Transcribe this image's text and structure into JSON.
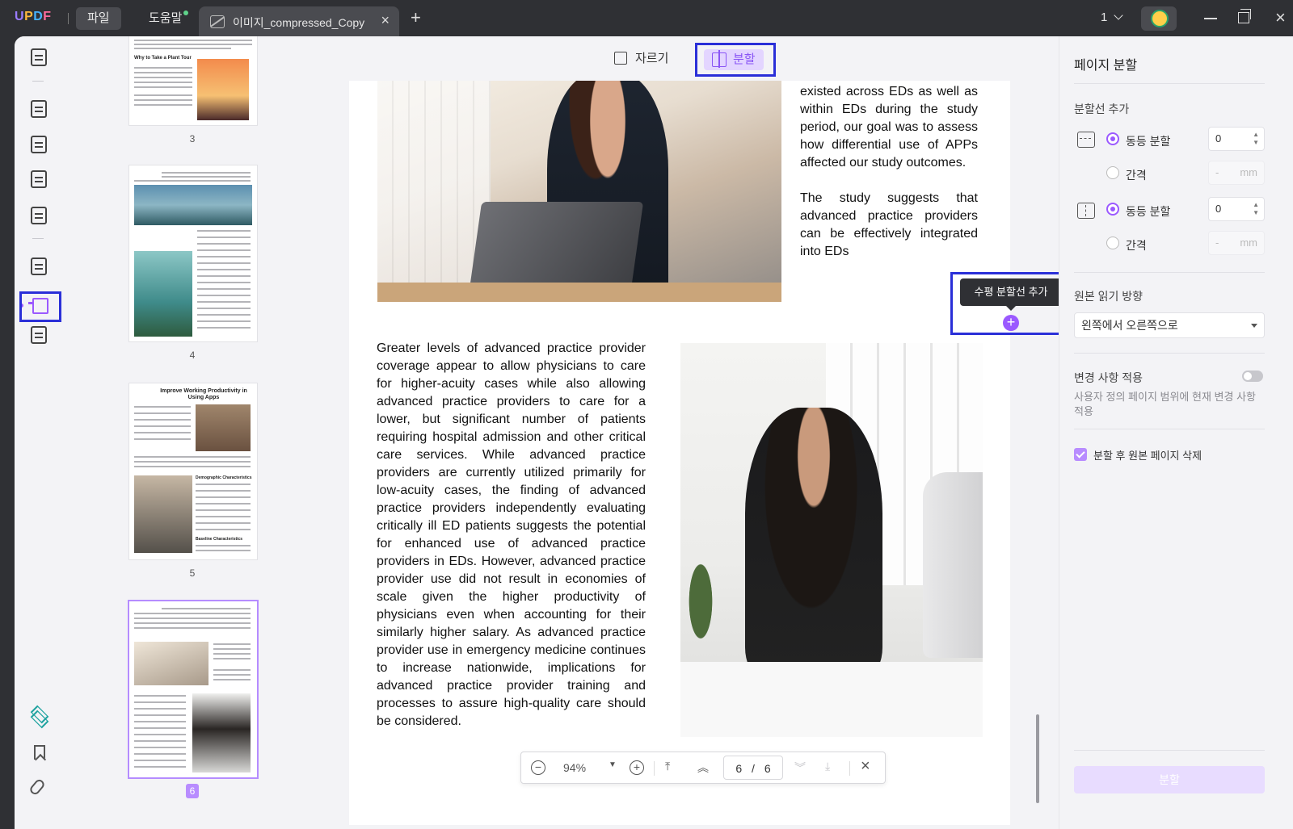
{
  "app": {
    "logo": "UPDF",
    "menu": [
      "파일",
      "도움말"
    ],
    "tab_title": "이미지_compressed_Copy",
    "page_indicator": "1",
    "accent_color": "#9b59ff"
  },
  "thumbnails": [
    {
      "page": "3",
      "heading": "Why to Take a Plant Tour",
      "selected": false
    },
    {
      "page": "4",
      "selected": false
    },
    {
      "page": "5",
      "heading": "Improve Working Productivity in Using Apps",
      "subheading_1": "Demographic Characteristics",
      "subheading_2": "Baseline Characteristics",
      "selected": false
    },
    {
      "page": "6",
      "selected": true
    }
  ],
  "subtoolbar": {
    "crop_label": "자르기",
    "split_label": "분할"
  },
  "document": {
    "right_para_1": "existed across EDs as well as within EDs during the study period, our goal was to assess how differential use of APPs affected our study outcomes.",
    "right_para_2": "The study suggests that advanced practice providers can be effectively integrated into EDs",
    "left_para": "Greater levels of advanced practice provider coverage appear to allow physicians to care for higher-acuity cases while also allowing advanced practice providers to care for a lower, but significant number of patients requiring hospital admission and other critical care services. While advanced practice providers are currently utilized primarily for low-acuity cases, the finding of advanced practice providers independently evaluating critically ill ED patients suggests the potential for enhanced use of advanced practice providers in EDs. However, advanced practice provider use did not result in economies of scale given the higher productivity of physicians even when accounting for their similarly higher salary. As advanced practice provider use in emergency medicine continues to increase nationwide, implications for advanced practice provider training and processes to assure high-quality care should be considered.",
    "tooltip": "수평 분할선 추가"
  },
  "navbar": {
    "zoom": "94%",
    "current_page": "6",
    "separator": "/",
    "total_pages": "6"
  },
  "panel": {
    "title": "페이지 분할",
    "add_divider_label": "분할선 추가",
    "horizontal": {
      "equal_label": "동등 분할",
      "equal_value": "0",
      "interval_label": "간격",
      "interval_dash": "-",
      "unit": "mm"
    },
    "vertical": {
      "equal_label": "동등 분할",
      "equal_value": "0",
      "interval_label": "간격",
      "interval_dash": "-",
      "unit": "mm"
    },
    "reading_direction_label": "원본 읽기 방향",
    "reading_direction_value": "왼쪽에서 오른쪽으로",
    "apply_changes_label": "변경 사항 적용",
    "apply_changes_desc": "사용자 정의 페이지 범위에 현재 변경 사항 적용",
    "delete_original_label": "분할 후 원본 페이지 삭제",
    "split_button": "분할"
  }
}
